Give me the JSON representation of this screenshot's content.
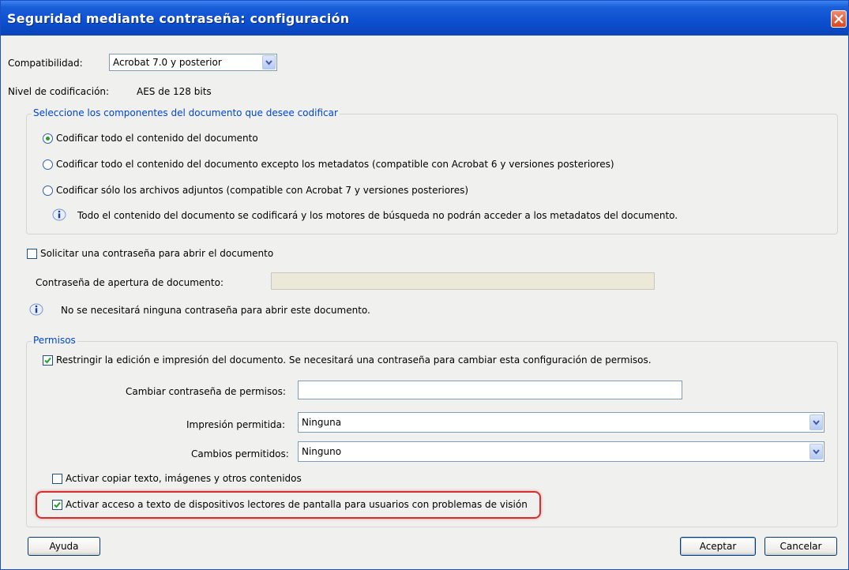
{
  "window": {
    "title": "Seguridad mediante contraseña: configuración"
  },
  "compat": {
    "label": "Compatibilidad:",
    "value": "Acrobat 7.0 y posterior"
  },
  "encryption_level": {
    "label": "Nivel de codificación:",
    "value": "AES de 128 bits"
  },
  "components_group": {
    "title": "Seleccione los componentes del documento que desee codificar",
    "options": [
      {
        "label": "Codificar todo el contenido del documento",
        "selected": true
      },
      {
        "label": "Codificar todo el contenido del documento excepto los metadatos (compatible con Acrobat 6 y versiones posteriores)",
        "selected": false
      },
      {
        "label": "Codificar sólo los archivos adjuntos (compatible con Acrobat 7 y versiones posteriores)",
        "selected": false
      }
    ],
    "info": "Todo el contenido del documento se codificará y los motores de búsqueda no podrán acceder a los metadatos del documento."
  },
  "open_password": {
    "checkbox_label": "Solicitar una contraseña para abrir el documento",
    "checked": false,
    "field_label": "Contraseña de apertura de documento:",
    "field_value": "",
    "info": "No se necesitará ninguna contraseña para abrir este documento."
  },
  "permissions": {
    "title": "Permisos",
    "restrict_label": "Restringir la edición e impresión del documento. Se necesitará una contraseña para cambiar esta configuración de permisos.",
    "restrict_checked": true,
    "change_password_label": "Cambiar contraseña de permisos:",
    "change_password_value": "",
    "printing_label": "Impresión permitida:",
    "printing_value": "Ninguna",
    "changes_label": "Cambios permitidos:",
    "changes_value": "Ninguno",
    "copy_label": "Activar copiar texto, imágenes y otros contenidos",
    "copy_checked": false,
    "screenreader_label": "Activar acceso a texto de dispositivos lectores de pantalla para usuarios con problemas de visión",
    "screenreader_checked": true
  },
  "buttons": {
    "help": "Ayuda",
    "ok": "Aceptar",
    "cancel": "Cancelar"
  },
  "colors": {
    "title_bar": "#0c4fd0",
    "group_label": "#0046d5",
    "highlight": "#d42f2f",
    "radio_dot": "#21a121"
  },
  "icons": [
    "close-icon",
    "chevron-down-icon",
    "info-icon",
    "checkmark-icon"
  ]
}
